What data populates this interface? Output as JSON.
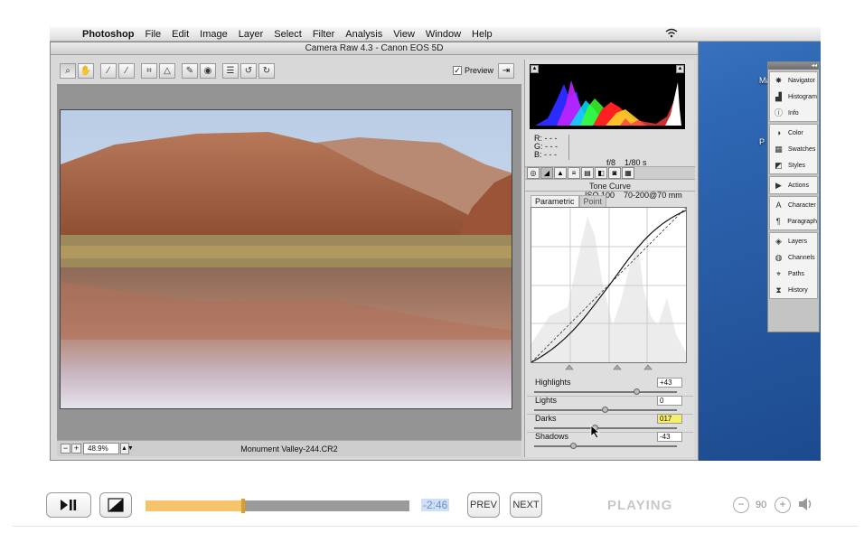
{
  "menubar": {
    "items": [
      "Photoshop",
      "File",
      "Edit",
      "Image",
      "Layer",
      "Select",
      "Filter",
      "Analysis",
      "View",
      "Window",
      "Help"
    ]
  },
  "desktop": {
    "disk1_label": "Macin",
    "disk2_label": "P"
  },
  "camera_raw": {
    "title": "Camera Raw 4.3  -  Canon EOS 5D",
    "preview_label": "Preview",
    "preview_checked": true,
    "zoom_value": "48.9%",
    "filename": "Monument Valley-244.CR2",
    "readout": {
      "r": "R:   - - -",
      "g": "G:   - - -",
      "b": "B:   - - -",
      "aperture_shutter": "f/8    1/80 s",
      "iso_lens": "ISO 100    70-200@70 mm"
    },
    "panel_title": "Tone Curve",
    "subtabs": [
      "Parametric",
      "Point"
    ],
    "sliders": [
      {
        "label": "Highlights",
        "value": "+43",
        "level": 0.72
      },
      {
        "label": "Lights",
        "value": "0",
        "level": 0.5
      },
      {
        "label": "Darks",
        "value": "017",
        "level": 0.43
      },
      {
        "label": "Shadows",
        "value": "-43",
        "level": 0.28
      }
    ]
  },
  "palettes": [
    [
      "Navigator",
      "Histogram",
      "Info"
    ],
    [
      "Color",
      "Swatches",
      "Styles"
    ],
    [
      "Actions"
    ],
    [
      "Character",
      "Paragraph"
    ],
    [
      "Layers",
      "Channels",
      "Paths",
      "History"
    ]
  ],
  "player": {
    "progress": 0.37,
    "time": "-2:46",
    "prev_label": "PREV",
    "next_label": "NEXT",
    "status": "PLAYING",
    "volume": "90"
  },
  "colors": {
    "progress_fill": "#f5c46a",
    "progress_knob": "#e09b2a",
    "darks_highlight": "#f7ef6a"
  }
}
